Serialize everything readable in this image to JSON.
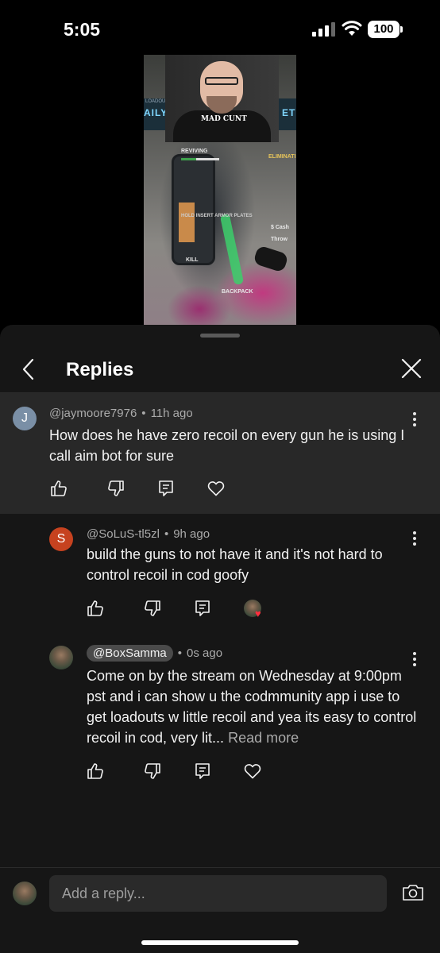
{
  "status_bar": {
    "time": "5:05",
    "battery": "100"
  },
  "video": {
    "side_left_top": "LOADOUT D",
    "side_left": "AILY",
    "side_right": "ETE",
    "shirt_text": "MAD CUNT",
    "hud_reviving": "REVIVING",
    "hud_eliminate": "ELIMINATI",
    "hud_cash": "$ Cash",
    "hud_throw": "Throw",
    "hud_backpack": "BACKPACK",
    "hud_plates": "HOLD  INSERT ARMOR PLATES",
    "hud_kill": "KILL"
  },
  "header": {
    "title": "Replies"
  },
  "parent_comment": {
    "avatar_letter": "J",
    "avatar_color": "#7a8fa6",
    "author": "@jaymoore7976",
    "time": "11h ago",
    "text": "How does he have zero recoil on every gun he is using I call aim bot for sure"
  },
  "replies": [
    {
      "avatar_letter": "S",
      "avatar_color": "#c6421f",
      "author": "@SoLuS-tl5zl",
      "time": "9h ago",
      "text": "build the guns to not have it and it's not hard to control recoil in cod goofy",
      "creator_heart": "♥"
    },
    {
      "author": "@BoxSamma",
      "time": "0s ago",
      "text": "Come on by the stream on Wednesday at 9:00pm pst and i can show u the codmmunity app i use to get loadouts w little recoil and yea its easy to control recoil in cod, very lit...",
      "read_more": "Read more"
    }
  ],
  "composer": {
    "placeholder": "Add a reply..."
  },
  "icons": {
    "like": "thumbs-up-icon",
    "dislike": "thumbs-down-icon",
    "reply": "reply-icon",
    "heart": "heart-icon",
    "camera": "camera-icon",
    "back": "chevron-left-icon",
    "close": "close-icon"
  }
}
